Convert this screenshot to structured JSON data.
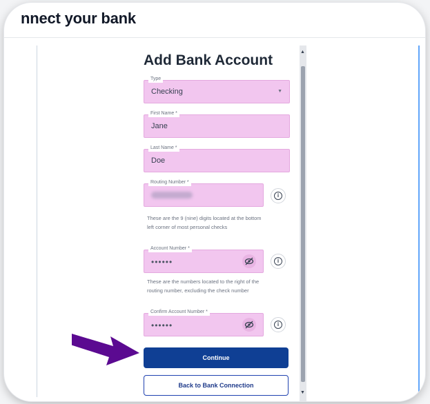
{
  "page": {
    "title": "nnect your bank"
  },
  "form": {
    "title": "Add Bank Account",
    "type": {
      "label": "Type",
      "value": "Checking"
    },
    "first_name": {
      "label": "First Name *",
      "value": "Jane"
    },
    "last_name": {
      "label": "Last Name *",
      "value": "Doe"
    },
    "routing_number": {
      "label": "Routing Number *",
      "help": "These are the 9 (nine) digits located at the bottom left corner of most personal checks"
    },
    "account_number": {
      "label": "Account Number *",
      "value": "••••••",
      "help": "These are the numbers located to the right of the routing number, excluding the check number"
    },
    "confirm_account_number": {
      "label": "Confirm Account Number *",
      "value": "••••••"
    },
    "continue_label": "Continue",
    "back_label": "Back to Bank Connection"
  },
  "colors": {
    "highlight": "#f2c6ef",
    "primary": "#0f3f94",
    "annotation_arrow": "#5b0a91"
  },
  "icons": [
    "chevron-down-icon",
    "eye-slash-icon",
    "info-icon",
    "scroll-up-icon",
    "scroll-down-icon",
    "annotation-arrow"
  ]
}
